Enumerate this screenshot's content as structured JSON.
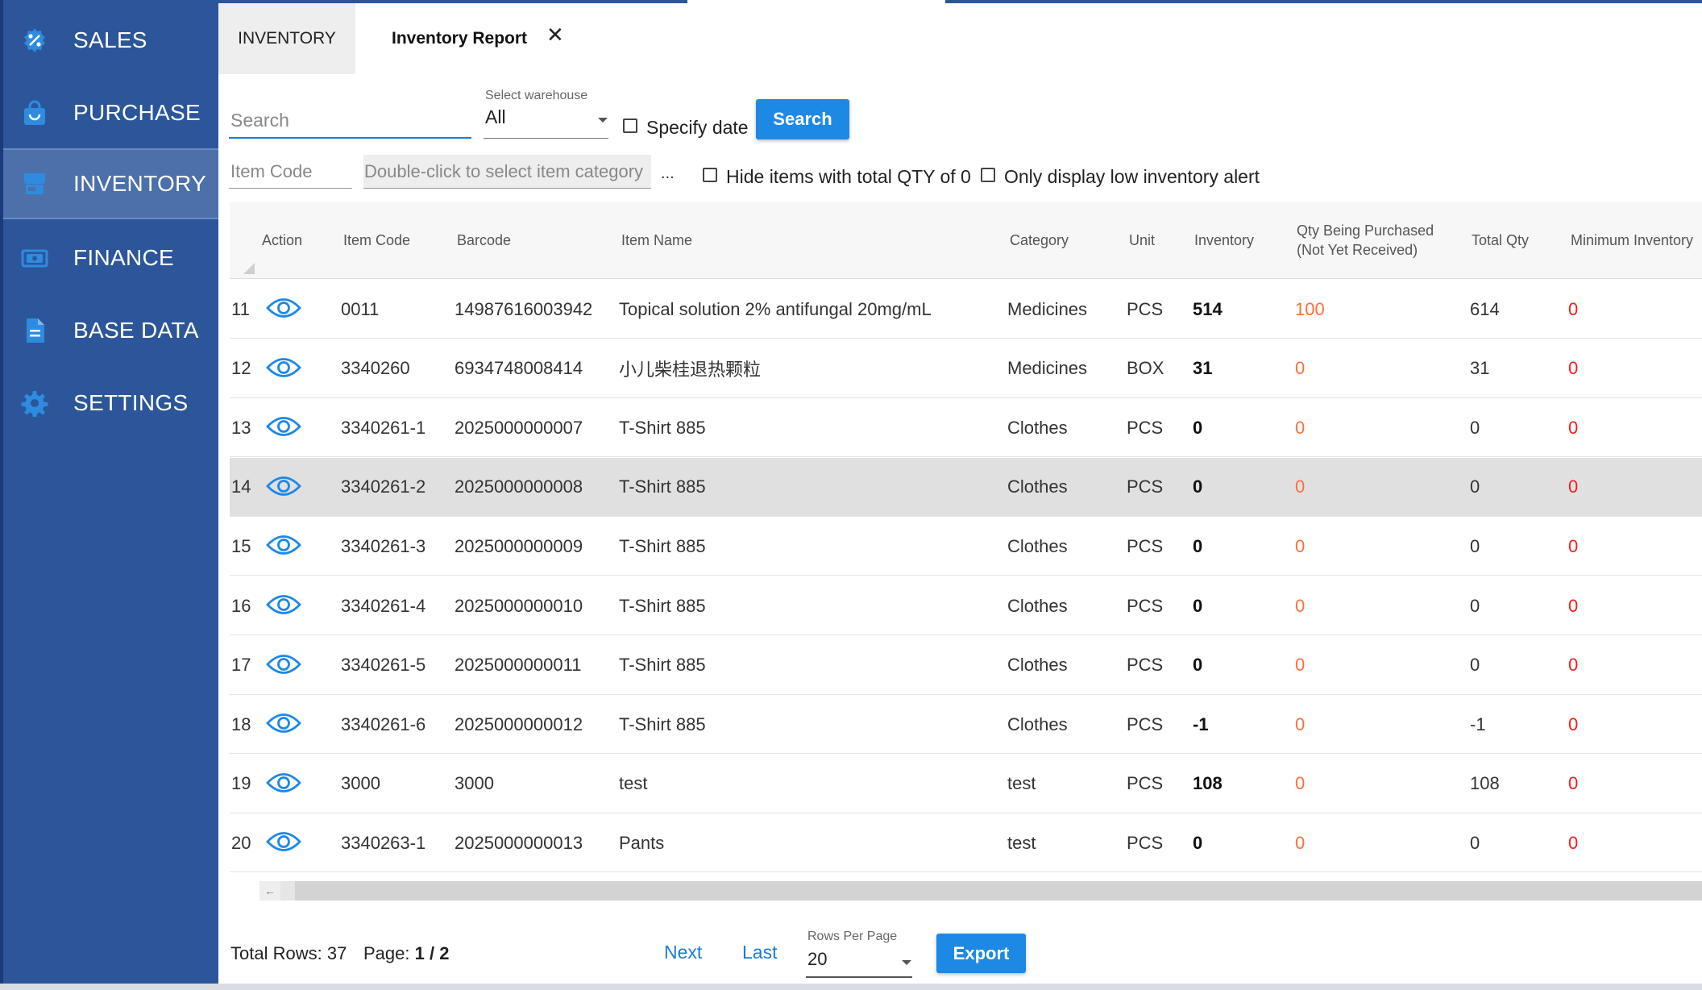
{
  "sidebar": {
    "items": [
      {
        "label": "SALES",
        "icon": "gear-percent-icon",
        "active": false
      },
      {
        "label": "PURCHASE",
        "icon": "shopping-bag-icon",
        "active": false
      },
      {
        "label": "INVENTORY",
        "icon": "store-icon",
        "active": true
      },
      {
        "label": "FINANCE",
        "icon": "money-icon",
        "active": false
      },
      {
        "label": "BASE DATA",
        "icon": "document-icon",
        "active": false
      },
      {
        "label": "SETTINGS",
        "icon": "gear-icon",
        "active": false
      }
    ]
  },
  "tabs": {
    "inventory": "INVENTORY",
    "report": "Inventory Report",
    "close": "✕"
  },
  "filters": {
    "search_placeholder": "Search",
    "warehouse_label": "Select warehouse",
    "warehouse_value": "All",
    "specify_date_label": "Specify date",
    "search_button": "Search",
    "item_code_placeholder": "Item Code",
    "category_placeholder": "Double-click to select item category",
    "category_more": "...",
    "hide_zero_label": "Hide items with total QTY of 0",
    "low_alert_label": "Only display low inventory alert"
  },
  "table": {
    "headers": {
      "action": "Action",
      "item_code": "Item Code",
      "barcode": "Barcode",
      "item_name": "Item Name",
      "category": "Category",
      "unit": "Unit",
      "inventory": "Inventory",
      "qty_purchasing_1": "Qty Being Purchased",
      "qty_purchasing_2": "(Not Yet Received)",
      "total_qty": "Total Qty",
      "min_inventory": "Minimum Inventory"
    },
    "rows": [
      {
        "no": "11",
        "code": "0011",
        "barcode": "14987616003942",
        "name": "Topical solution 2% antifungal 20mg/mL",
        "category": "Medicines",
        "unit": "PCS",
        "inventory": "514",
        "purchasing": "100",
        "total": "614",
        "min": "0"
      },
      {
        "no": "12",
        "code": "3340260",
        "barcode": "6934748008414",
        "name": "小儿柴桂退热颗粒",
        "category": "Medicines",
        "unit": "BOX",
        "inventory": "31",
        "purchasing": "0",
        "total": "31",
        "min": "0"
      },
      {
        "no": "13",
        "code": "3340261-1",
        "barcode": "2025000000007",
        "name": "T-Shirt 885",
        "category": "Clothes",
        "unit": "PCS",
        "inventory": "0",
        "purchasing": "0",
        "total": "0",
        "min": "0"
      },
      {
        "no": "14",
        "code": "3340261-2",
        "barcode": "2025000000008",
        "name": "T-Shirt 885",
        "category": "Clothes",
        "unit": "PCS",
        "inventory": "0",
        "purchasing": "0",
        "total": "0",
        "min": "0"
      },
      {
        "no": "15",
        "code": "3340261-3",
        "barcode": "2025000000009",
        "name": "T-Shirt 885",
        "category": "Clothes",
        "unit": "PCS",
        "inventory": "0",
        "purchasing": "0",
        "total": "0",
        "min": "0"
      },
      {
        "no": "16",
        "code": "3340261-4",
        "barcode": "2025000000010",
        "name": "T-Shirt 885",
        "category": "Clothes",
        "unit": "PCS",
        "inventory": "0",
        "purchasing": "0",
        "total": "0",
        "min": "0"
      },
      {
        "no": "17",
        "code": "3340261-5",
        "barcode": "2025000000011",
        "name": "T-Shirt 885",
        "category": "Clothes",
        "unit": "PCS",
        "inventory": "0",
        "purchasing": "0",
        "total": "0",
        "min": "0"
      },
      {
        "no": "18",
        "code": "3340261-6",
        "barcode": "2025000000012",
        "name": "T-Shirt 885",
        "category": "Clothes",
        "unit": "PCS",
        "inventory": "-1",
        "purchasing": "0",
        "total": "-1",
        "min": "0"
      },
      {
        "no": "19",
        "code": "3000",
        "barcode": "3000",
        "name": "test",
        "category": "test",
        "unit": "PCS",
        "inventory": "108",
        "purchasing": "0",
        "total": "108",
        "min": "0"
      },
      {
        "no": "20",
        "code": "3340263-1",
        "barcode": "2025000000013",
        "name": "Pants",
        "category": "test",
        "unit": "PCS",
        "inventory": "0",
        "purchasing": "0",
        "total": "0",
        "min": "0"
      }
    ],
    "highlighted_row": "14",
    "scroll_left": "←"
  },
  "footer": {
    "total_rows_label": "Total Rows:",
    "total_rows": "37",
    "page_label": "Page:",
    "page_value": "1 / 2",
    "next": "Next",
    "last": "Last",
    "rows_per_page_label": "Rows Per Page",
    "rows_per_page": "20",
    "export": "Export"
  },
  "colors": {
    "sidebar": "#2c5699",
    "sidebar_active": "#4c70aa",
    "accent": "#1e88e5",
    "purchasing_text": "#ff6d3a",
    "min_inventory_text": "#ff1a1a"
  }
}
